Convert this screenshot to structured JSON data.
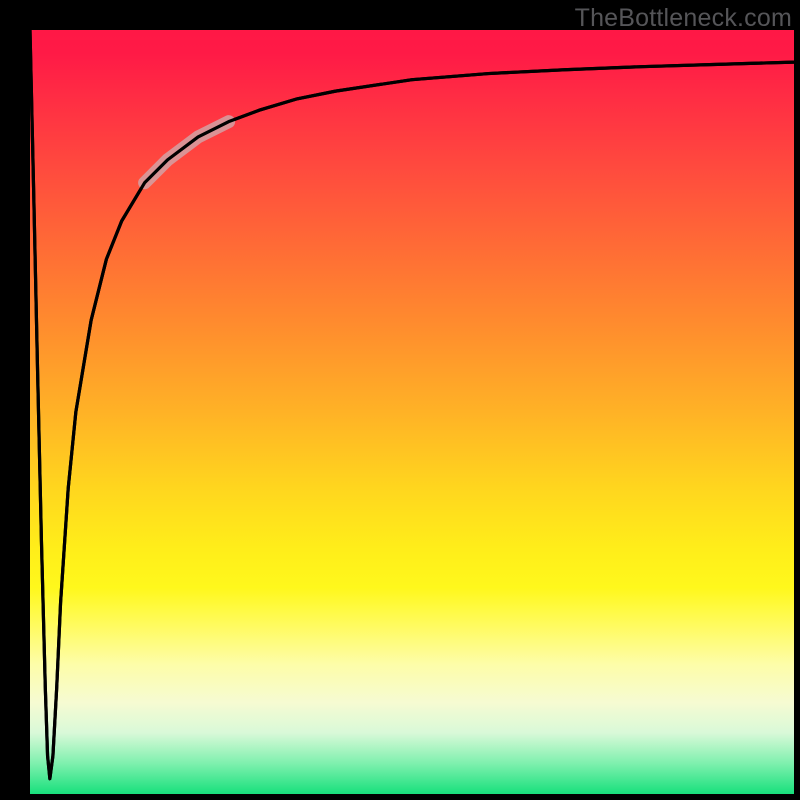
{
  "watermark": "TheBottleneck.com",
  "chart_data": {
    "type": "line",
    "title": "",
    "xlabel": "",
    "ylabel": "",
    "xlim": [
      0,
      100
    ],
    "ylim": [
      0,
      100
    ],
    "grid": false,
    "background_gradient": {
      "stops": [
        {
          "pos": 0.0,
          "color": "#ff1846"
        },
        {
          "pos": 0.5,
          "color": "#ffb226"
        },
        {
          "pos": 0.78,
          "color": "#fffb60"
        },
        {
          "pos": 1.0,
          "color": "#18e07c"
        }
      ],
      "orientation": "vertical"
    },
    "series": [
      {
        "name": "main-curve",
        "color": "#000000",
        "x": [
          0.0,
          0.5,
          1.0,
          1.5,
          2.0,
          2.3,
          2.6,
          3.0,
          3.5,
          4.0,
          5.0,
          6.0,
          8.0,
          10.0,
          12.0,
          15.0,
          18.0,
          22.0,
          26.0,
          30.0,
          35.0,
          40.0,
          50.0,
          60.0,
          70.0,
          80.0,
          90.0,
          100.0
        ],
        "y": [
          100,
          78,
          55,
          33,
          14,
          5,
          2,
          5,
          14,
          25,
          40,
          50,
          62,
          70,
          75,
          80,
          83,
          86,
          88,
          89.5,
          91,
          92,
          93.5,
          94.3,
          94.8,
          95.2,
          95.5,
          95.8
        ]
      },
      {
        "name": "highlight-segment",
        "color": "#d3a1a5",
        "x": [
          15.0,
          18.0,
          22.0,
          26.0
        ],
        "y": [
          80.0,
          83.0,
          86.0,
          88.0
        ]
      }
    ]
  }
}
